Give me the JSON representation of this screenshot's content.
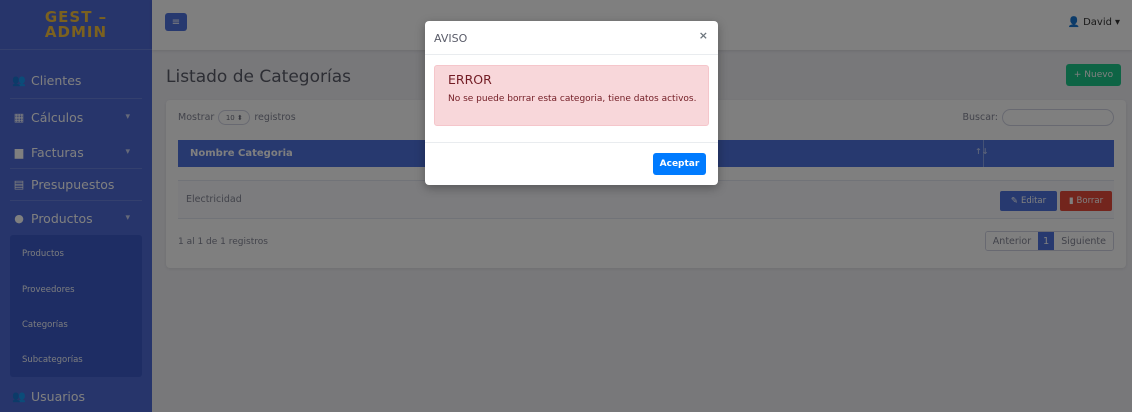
{
  "sidebar": {
    "brand_line1": "GEST –",
    "brand_line2": "ADMIN",
    "items": [
      {
        "label": "Clientes",
        "icon": "users-icon",
        "glyph": "👥"
      },
      {
        "label": "Cálculos",
        "icon": "calculator-icon",
        "glyph": "▦"
      },
      {
        "label": "Facturas",
        "icon": "file-icon",
        "glyph": "▆"
      },
      {
        "label": "Presupuestos",
        "icon": "file-text-icon",
        "glyph": "▤"
      },
      {
        "label": "Productos",
        "icon": "product-hunt-icon",
        "glyph": "●"
      },
      {
        "label": "Usuarios",
        "icon": "users-cog-icon",
        "glyph": "👥"
      }
    ],
    "submenu": [
      "Productos",
      "Proveedores",
      "Categorías",
      "Subcategorías"
    ]
  },
  "topbar": {
    "toggle_glyph": "≡",
    "user_name": "David",
    "user_glyph": "👤",
    "caret": "▾"
  },
  "page": {
    "title": "Listado de Categorías",
    "new_button": "+ Nuevo"
  },
  "table": {
    "show_prefix": "Mostrar",
    "show_value": "10 ⬍",
    "show_suffix": "registros",
    "search_label": "Buscar:",
    "column": "Nombre Categoria",
    "sort_glyph": "↑↓",
    "rows": [
      {
        "name": "Electricidad"
      }
    ],
    "edit_label": "Editar",
    "delete_label": "Borrar",
    "info": "1 al 1 de 1 registros",
    "prev": "Anterior",
    "page": "1",
    "next": "Siguiente"
  },
  "modal": {
    "title": "AVISO",
    "close": "×",
    "alert_title": "ERROR",
    "alert_message": "No se puede borrar esta categoria, tiene datos activos.",
    "ok_button": "Aceptar"
  },
  "colors": {
    "sidebar": "#4f6ad6",
    "primary": "#4e73df",
    "success": "#1cc88a",
    "danger": "#e74a3b",
    "brand_text": "#f6c23e"
  }
}
